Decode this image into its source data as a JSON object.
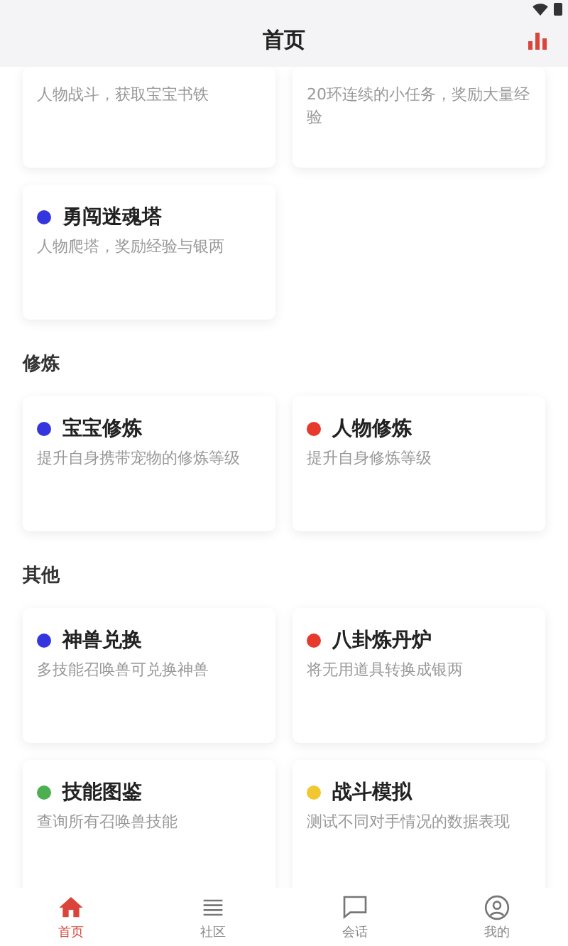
{
  "header": {
    "title": "首页"
  },
  "top_cards": [
    {
      "description": "人物战斗，获取宝宝书铁"
    },
    {
      "description": "20环连续的小任务，奖励大量经验"
    }
  ],
  "first_cards": [
    {
      "title": "勇闯迷魂塔",
      "description": "人物爬塔，奖励经验与银两",
      "color": "#3535e0"
    }
  ],
  "sections": [
    {
      "title": "修炼",
      "cards": [
        {
          "title": "宝宝修炼",
          "description": "提升自身携带宠物的修炼等级",
          "color": "#3535e0"
        },
        {
          "title": "人物修炼",
          "description": "提升自身修炼等级",
          "color": "#e53a2c"
        }
      ]
    },
    {
      "title": "其他",
      "cards": [
        {
          "title": "神兽兑换",
          "description": "多技能召唤兽可兑换神兽",
          "color": "#3535e0"
        },
        {
          "title": "八卦炼丹炉",
          "description": "将无用道具转换成银两",
          "color": "#e53a2c"
        },
        {
          "title": "技能图鉴",
          "description": "查询所有召唤兽技能",
          "color": "#4caf50"
        },
        {
          "title": "战斗模拟",
          "description": "测试不同对手情况的数据表现",
          "color": "#f2c832"
        }
      ]
    }
  ],
  "tabs": [
    {
      "kind": "home",
      "label": "首页",
      "selected": true
    },
    {
      "kind": "list",
      "label": "社区",
      "selected": false
    },
    {
      "kind": "chat",
      "label": "会话",
      "selected": false
    },
    {
      "kind": "user",
      "label": "我的",
      "selected": false
    }
  ]
}
